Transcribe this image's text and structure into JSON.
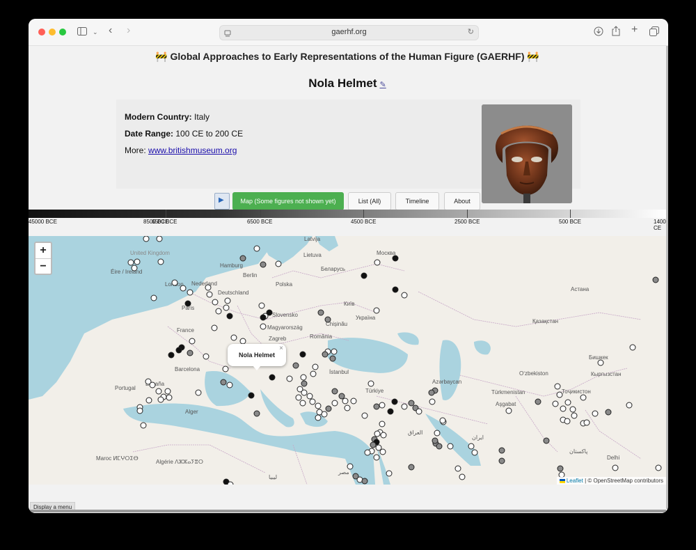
{
  "browser": {
    "url": "gaerhf.org",
    "colors": {
      "close": "#ff5f57",
      "minimize": "#febc2e",
      "maximize": "#28c840"
    }
  },
  "site": {
    "title": "🚧 Global Approaches to Early Representations of the Human Figure (GAERHF) 🚧"
  },
  "object": {
    "name": "Nola Helmet",
    "edit_icon": "✎",
    "country_label": "Modern Country:",
    "country_value": "Italy",
    "date_label": "Date Range:",
    "date_value": "100 CE to 200 CE",
    "more_label": "More:",
    "more_link": "www.britishmuseum.org"
  },
  "nav": {
    "play_icon": "▶",
    "map_label": "Map (Some figures not shown yet)",
    "list_label": "List (All)",
    "timeline_label": "Timeline",
    "about_label": "About",
    "active_color": "#4caf50"
  },
  "timeline": {
    "labels": [
      "45000 BCE",
      "8500 BCE",
      "6500 BCE",
      "4500 BCE",
      "2500 BCE",
      "500 BCE",
      "1400 CE"
    ],
    "label_overlap": "6500 BCE"
  },
  "map": {
    "zoom_in": "+",
    "zoom_out": "−",
    "popup_title": "Nola Helmet",
    "popup_close": "×",
    "attribution_leaflet": "Leaflet",
    "attribution_osm": "| © OpenStreetMap contributors",
    "labels": {
      "uk": "United Kingdom",
      "ireland": "Éire / Ireland",
      "france": "France",
      "espana": "España",
      "portugal": "Portugal",
      "barcelona": "Barcelona",
      "alger": "Alger",
      "algerie": "Algérie ⴷⵣⵣⴰⵢⴻⵔ",
      "maroc": "Maroc ⵍⵎⵖⵔⵉⴱ",
      "deutschland": "Deutschland",
      "nederland": "Nederland",
      "polska": "Polska",
      "belarus": "Беларусь",
      "moskva": "Москва",
      "latvija": "Latvija",
      "lietuva": "Lietuva",
      "kyiv": "Київ",
      "ukraina": "Україна",
      "magyarorszag": "Magyarország",
      "slovensko": "Slovensko",
      "romania": "România",
      "chisinau": "Chișinău",
      "zagreb": "Zagreb",
      "istanbul": "İstanbul",
      "turkiye": "Türkiye",
      "azarbaycan": "Azərbaycan",
      "kazakhstan": "Қазақстан",
      "astana": "Астана",
      "uzbekiston": "Oʻzbekiston",
      "turkmenistan": "Türkmenistan",
      "ashgabat": "Aşgabat",
      "bishkek": "Бишкек",
      "kyrgyzstan": "Кыргызстан",
      "tojikiston": "Тоҷикистон",
      "iran": "ایران",
      "iraq": "العراق",
      "pakistan": "پاکستان",
      "delhi": "Delhi",
      "hamburg": "Hamburg",
      "berlin": "Berlin",
      "london": "London",
      "paris": "Paris",
      "libya": "ليبيا",
      "misr": "مصر"
    }
  },
  "footer": {
    "menu_button": "Display a menu"
  }
}
